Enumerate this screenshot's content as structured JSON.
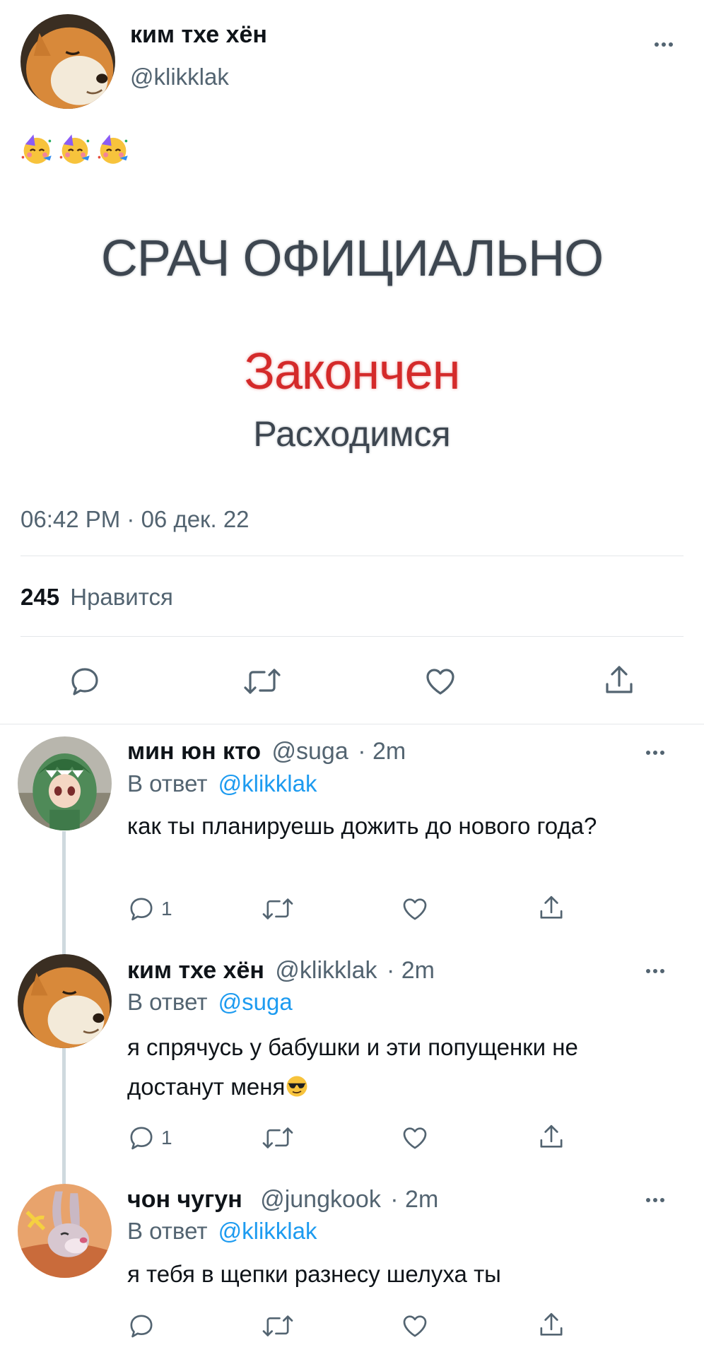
{
  "main_tweet": {
    "display_name": "ким тхе хён",
    "handle": "@klikklak",
    "image_text": {
      "line1": "СРАЧ ОФИЦИАЛЬНО",
      "line2": "Закончен",
      "line3": "Расходимся"
    },
    "timestamp": "06:42 PM · 06 дек. 22",
    "likes_count": "245",
    "likes_label": "Нравится"
  },
  "replies": [
    {
      "display_name": "мин юн кто",
      "handle": "@suga",
      "time": "· 2m",
      "reply_prefix": "В ответ",
      "reply_to": "@klikklak",
      "text": "как ты планируешь дожить до нового года?",
      "reply_count": "1"
    },
    {
      "display_name": "ким тхе хён",
      "handle": "@klikklak",
      "time": "· 2m",
      "reply_prefix": "В ответ",
      "reply_to": "@suga",
      "text": "я спрячусь у бабушки и эти попущенки не достанут меня",
      "reply_count": "1"
    },
    {
      "display_name": "чон чугун",
      "handle": "@jungkook",
      "time": "· 2m",
      "reply_prefix": "В ответ",
      "reply_to": "@klikklak",
      "text": "я тебя в щепки разнесу шелуха ты",
      "reply_count": ""
    }
  ],
  "colors": {
    "accent": "#1d9bf0",
    "secondary_text": "#536471",
    "divider": "#e4e7ea",
    "red_text": "#d42a2a"
  },
  "icons": [
    "more-icon",
    "reply-icon",
    "retweet-icon",
    "like-icon",
    "share-icon",
    "partying-face-emoji",
    "sunglasses-emoji"
  ]
}
